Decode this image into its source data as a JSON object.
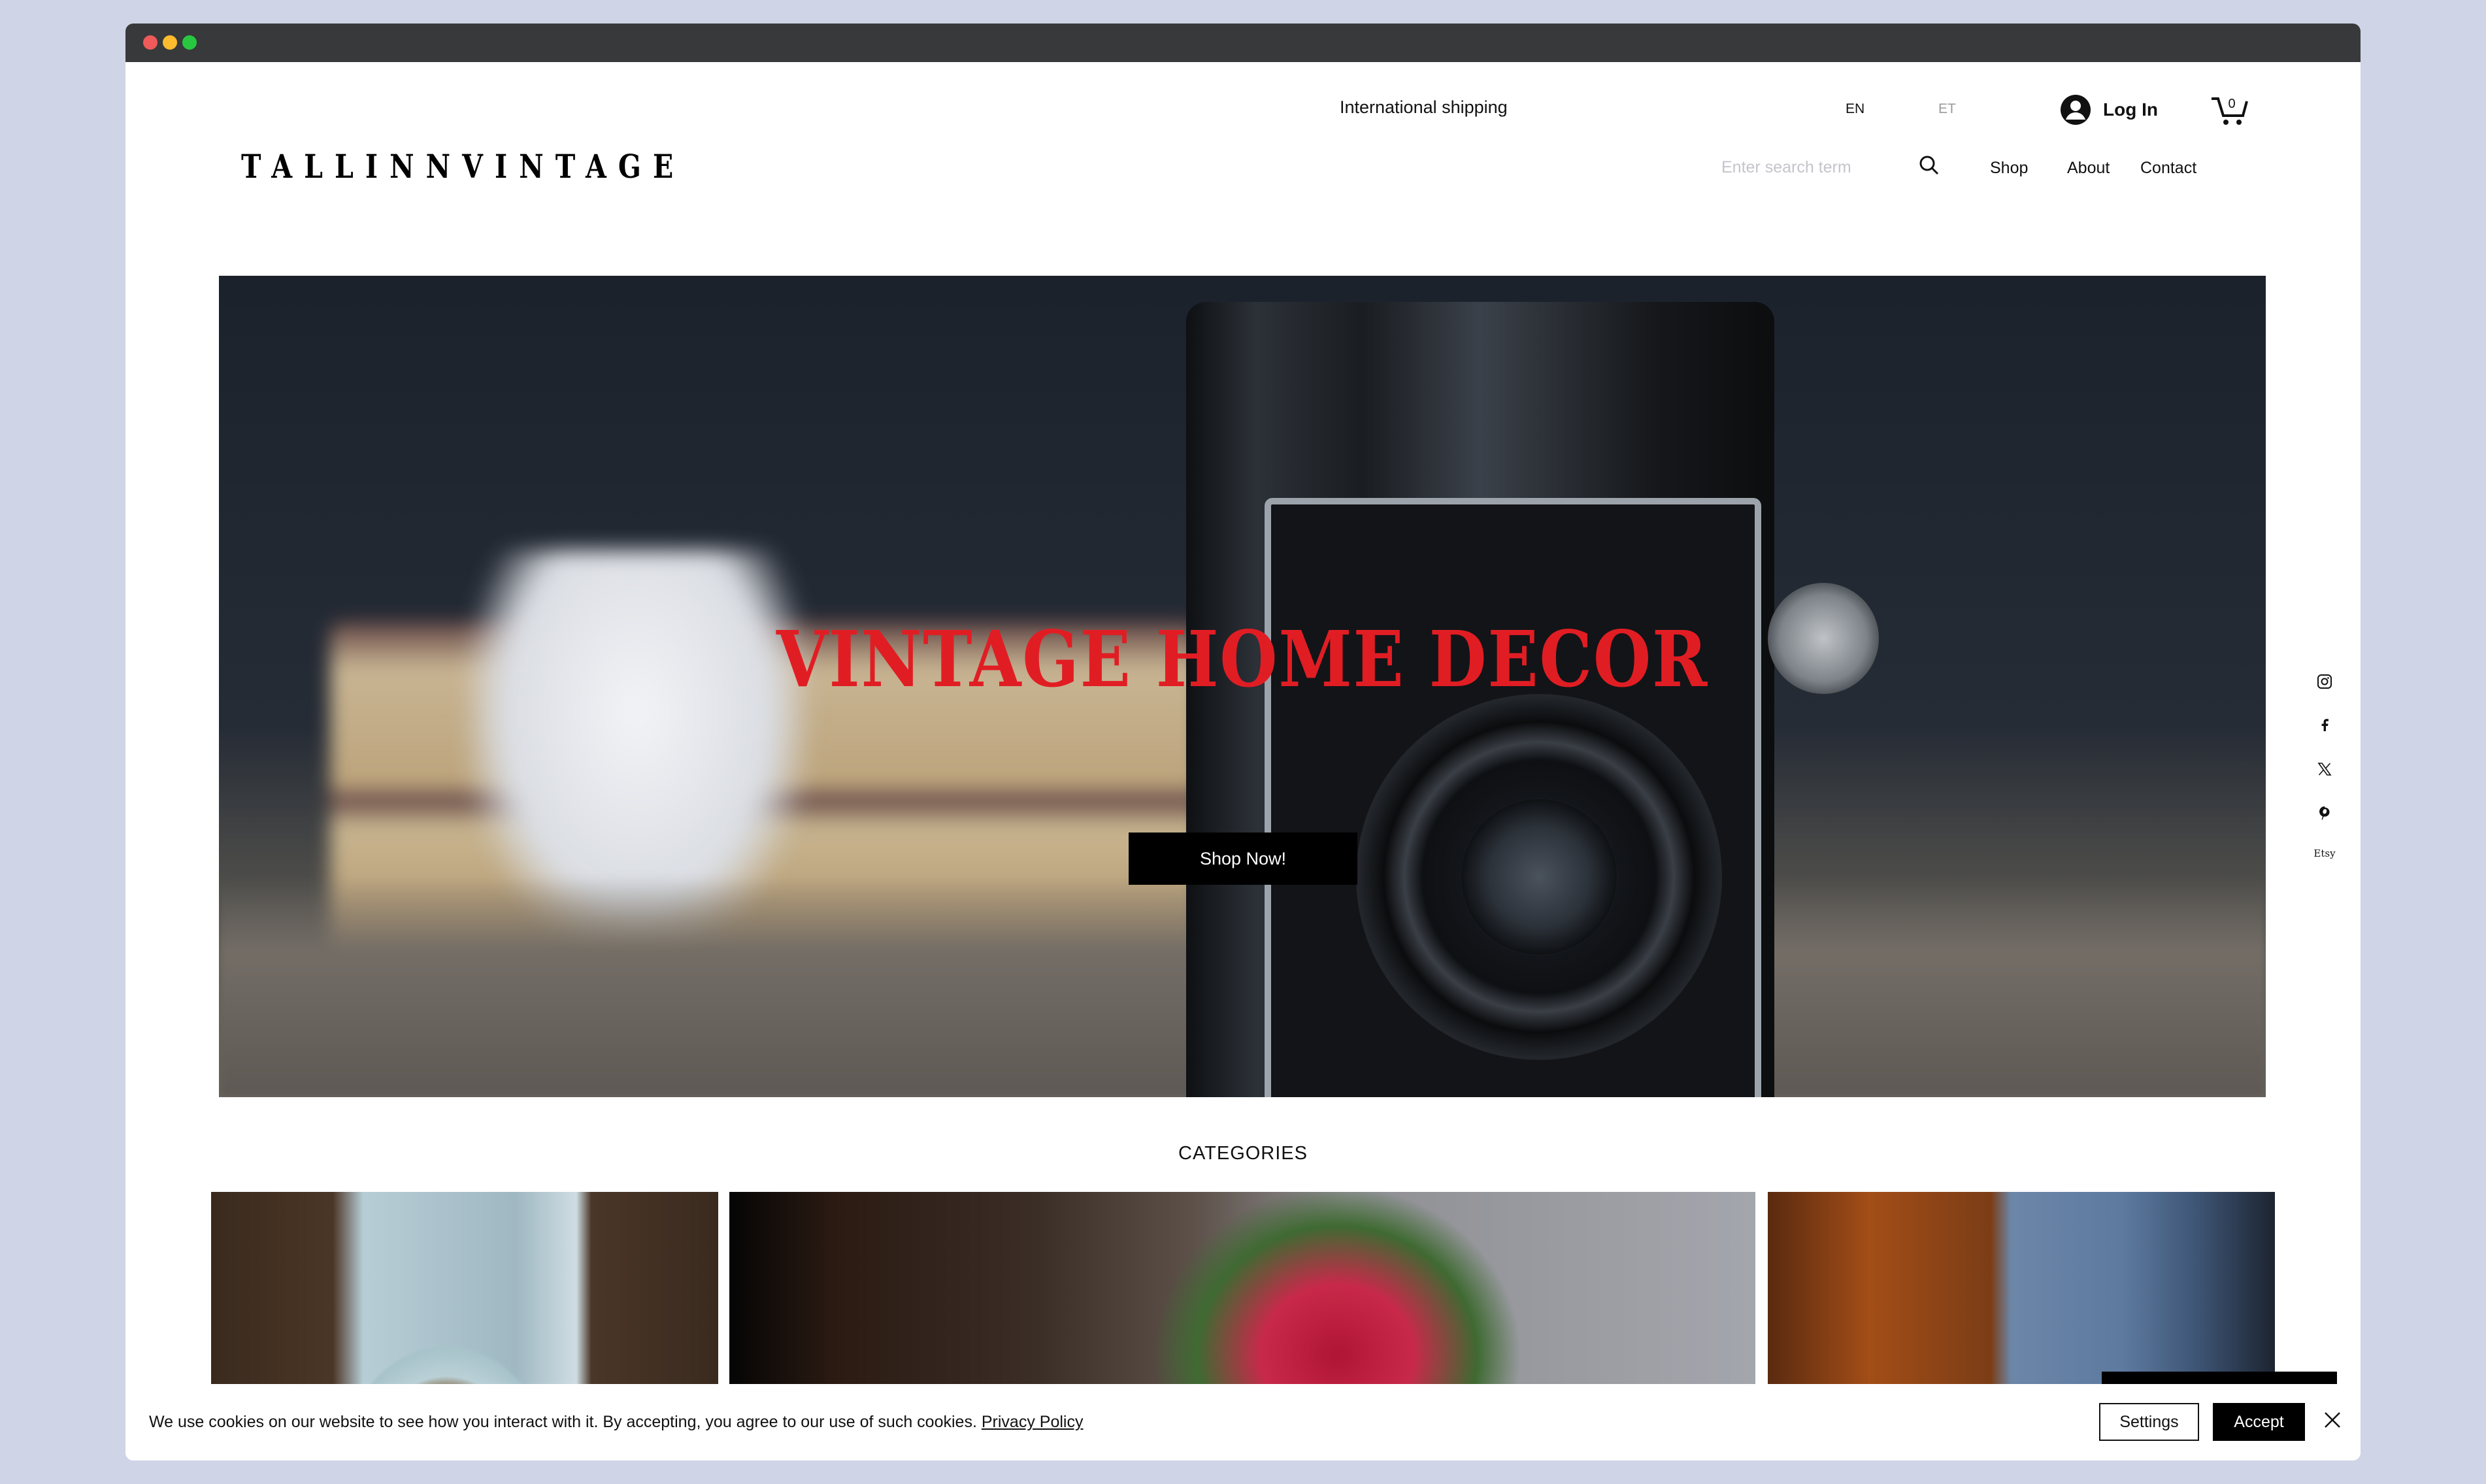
{
  "browser": {
    "controls": [
      "close",
      "minimize",
      "maximize"
    ]
  },
  "header": {
    "logo": "TALLINNVINTAGE",
    "announcement": "International shipping",
    "languages": [
      {
        "code": "EN",
        "active": true
      },
      {
        "code": "ET",
        "active": false
      }
    ],
    "login_label": "Log In",
    "cart_count": "0",
    "search_placeholder": "Enter search term",
    "nav": [
      "Shop",
      "About",
      "Contact"
    ]
  },
  "hero": {
    "title": "VINTAGE HOME DECOR",
    "cta_label": "Shop Now!",
    "title_color": "#e11d24"
  },
  "social": {
    "icons": [
      "instagram-icon",
      "facebook-icon",
      "x-icon",
      "pinterest-icon"
    ],
    "etsy_label": "Etsy"
  },
  "categories": {
    "heading": "CATEGORIES",
    "items": [
      {
        "image": "tableware-coffee-cup"
      },
      {
        "image": "red-anemone-flowers"
      },
      {
        "image": "candles-window"
      }
    ]
  },
  "cookie_banner": {
    "message": "We use cookies on our website to see how you interact with it. By accepting, you agree to our use of such cookies.",
    "policy_link": "Privacy Policy",
    "settings_label": "Settings",
    "accept_label": "Accept"
  }
}
